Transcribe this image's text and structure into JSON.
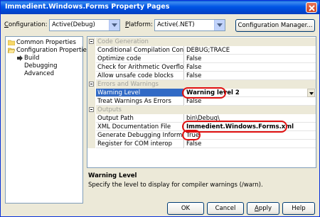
{
  "window": {
    "title": "Immedient.Windows.Forms Property Pages",
    "close_glyph": "close-x"
  },
  "config_bar": {
    "configuration_label": "Configuration:",
    "configuration_value": "Active(Debug)",
    "platform_label": "Platform:",
    "platform_value": "Active(.NET)",
    "manager_button": "Configuration Manager..."
  },
  "tree": {
    "items": [
      {
        "label": "Common Properties",
        "icon": "folder-icon"
      },
      {
        "label": "Configuration Properties",
        "icon": "folder-open-icon"
      },
      {
        "label": "Build",
        "icon": "arrow-right-icon"
      },
      {
        "label": "Debugging",
        "icon": ""
      },
      {
        "label": "Advanced",
        "icon": ""
      }
    ]
  },
  "grid": {
    "rows": [
      {
        "type": "category",
        "name": "Code Generation"
      },
      {
        "type": "property",
        "name": "Conditional Compilation Constants",
        "value": "DEBUG;TRACE"
      },
      {
        "type": "property",
        "name": "Optimize code",
        "value": "False"
      },
      {
        "type": "property",
        "name": "Check for Arithmetic Overflow/Underflow",
        "value": "False"
      },
      {
        "type": "property",
        "name": "Allow unsafe code blocks",
        "value": "False"
      },
      {
        "type": "category",
        "name": "Errors and Warnings"
      },
      {
        "type": "property",
        "name": "Warning Level",
        "value": "Warning level 2",
        "selected": true
      },
      {
        "type": "property",
        "name": "Treat Warnings As Errors",
        "value": "False"
      },
      {
        "type": "category",
        "name": "Outputs"
      },
      {
        "type": "property",
        "name": "Output Path",
        "value": "bin\\Debug\\"
      },
      {
        "type": "property",
        "name": "XML Documentation File",
        "value": "Immedient.Windows.Forms.xml"
      },
      {
        "type": "property",
        "name": "Generate Debugging Information",
        "value": "True"
      },
      {
        "type": "property",
        "name": "Register for COM interop",
        "value": "False"
      }
    ]
  },
  "description": {
    "title": "Warning Level",
    "text": "Specify the level to display for compiler warnings (/warn)."
  },
  "buttons": {
    "ok": "OK",
    "cancel": "Cancel",
    "apply": "Apply",
    "help": "Help"
  },
  "colors": {
    "title_bar": "#0055e5",
    "selection": "#316ac5",
    "highlight_oval": "#e01010",
    "dialog_face": "#ece9d8"
  }
}
